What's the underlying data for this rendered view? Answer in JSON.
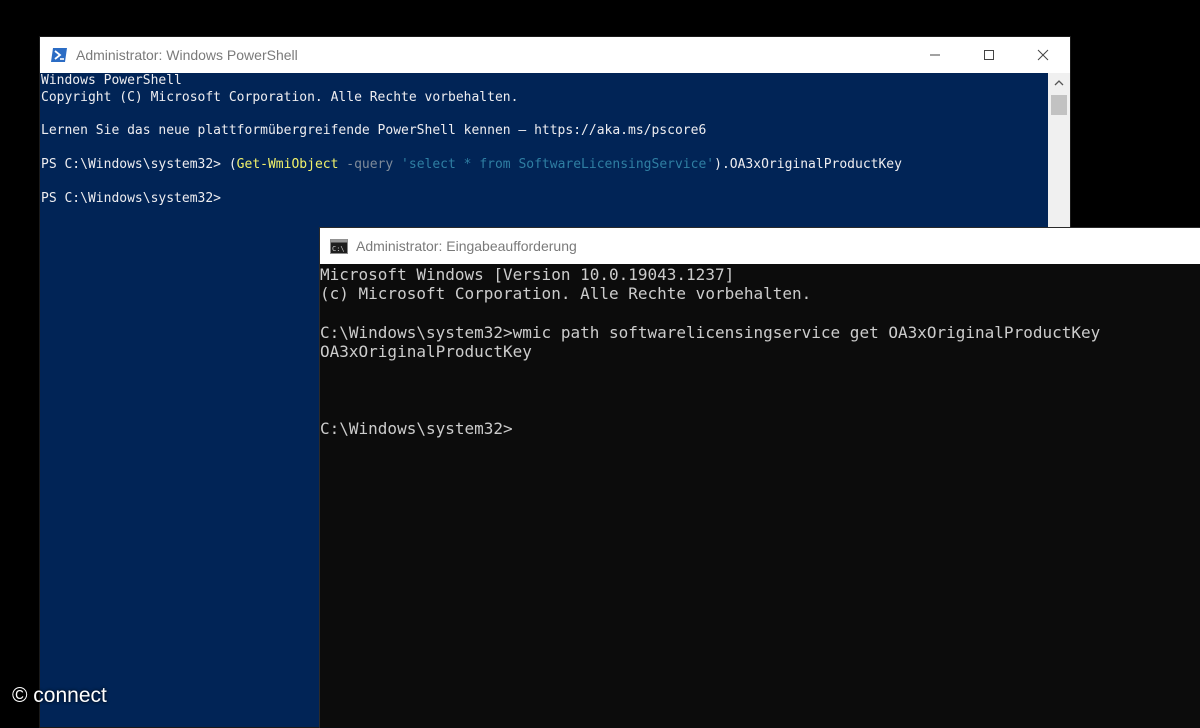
{
  "powershell": {
    "title": "Administrator: Windows PowerShell",
    "lines": [
      "Windows PowerShell",
      "Copyright (C) Microsoft Corporation. Alle Rechte vorbehalten.",
      "",
      "Lernen Sie das neue plattformübergreifende PowerShell kennen – https://aka.ms/pscore6",
      ""
    ],
    "command": {
      "prompt": "PS C:\\Windows\\system32> ",
      "open_paren": "(",
      "cmdlet": "Get-WmiObject",
      "space1": " ",
      "param": "-query",
      "space2": " ",
      "string": "'select * from SoftwareLicensingService'",
      "tail": ").OA3xOriginalProductKey"
    },
    "blank_after_command": "",
    "final_prompt": "PS C:\\Windows\\system32>",
    "icon": "powershell-icon",
    "colors": {
      "background": "#012456",
      "cmdlet": "#f1f16a",
      "param": "#7f8b9a",
      "string": "#2f7fa3"
    }
  },
  "cmd": {
    "title": "Administrator: Eingabeaufforderung",
    "lines": [
      "Microsoft Windows [Version 10.0.19043.1237]",
      "(c) Microsoft Corporation. Alle Rechte vorbehalten.",
      "",
      "C:\\Windows\\system32>wmic path softwarelicensingservice get OA3xOriginalProductKey",
      "OA3xOriginalProductKey",
      "",
      "",
      "",
      "C:\\Windows\\system32>"
    ],
    "icon": "cmd-icon",
    "colors": {
      "background": "#0c0c0c"
    }
  },
  "window_controls": {
    "minimize": "minimize-icon",
    "maximize": "maximize-icon",
    "close": "close-icon"
  },
  "watermark": "© connect"
}
